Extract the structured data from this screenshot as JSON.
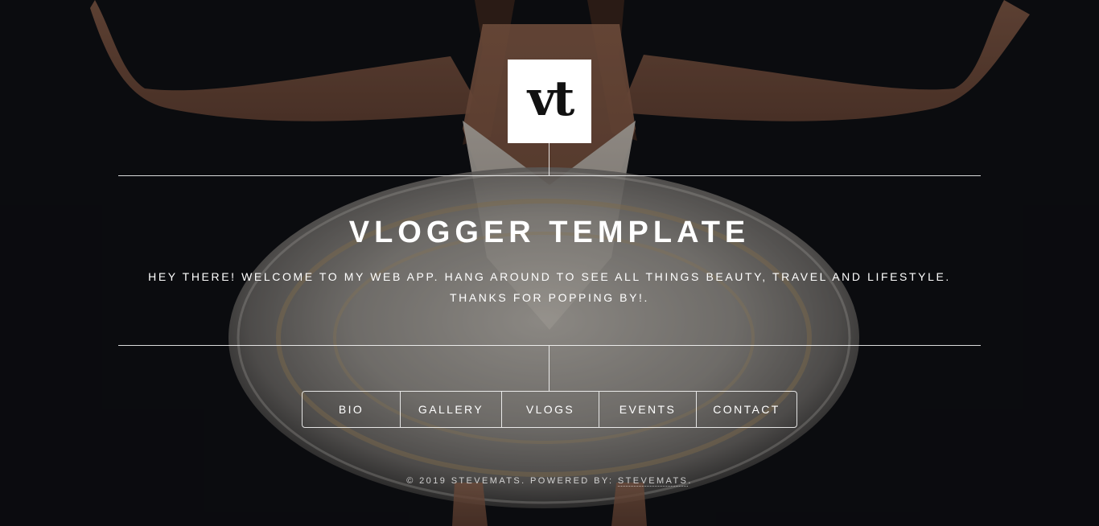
{
  "logo": {
    "text": "vt"
  },
  "hero": {
    "title": "VLOGGER TEMPLATE",
    "intro": "HEY THERE! WELCOME TO MY WEB APP. HANG AROUND TO SEE ALL THINGS BEAUTY, TRAVEL AND LIFESTYLE. THANKS FOR POPPING BY!."
  },
  "nav": {
    "items": [
      {
        "label": "BIO"
      },
      {
        "label": "GALLERY"
      },
      {
        "label": "VLOGS"
      },
      {
        "label": "EVENTS"
      },
      {
        "label": "CONTACT"
      }
    ]
  },
  "footer": {
    "prefix": "© 2019 STEVEMATS. POWERED BY: ",
    "link": "STEVEMATS",
    "suffix": "."
  },
  "colors": {
    "background": "#0b0c0f",
    "text": "#ffffff",
    "logo_bg": "#ffffff",
    "logo_text": "#111111"
  }
}
